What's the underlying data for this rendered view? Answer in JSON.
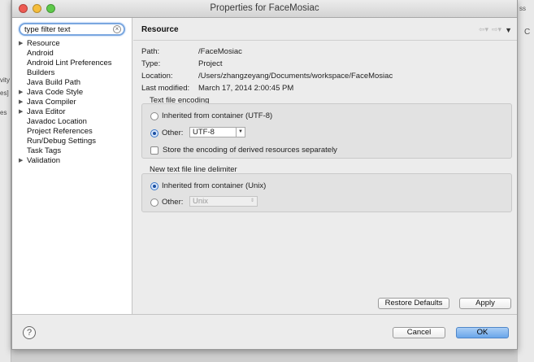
{
  "window": {
    "title": "Properties for FaceMosiac"
  },
  "background": {
    "left_fragments": [
      "vity",
      "es]",
      "es"
    ],
    "right_fragments": [
      "ss",
      "C"
    ]
  },
  "filter": {
    "value": "type filter text"
  },
  "tree": [
    {
      "label": "Resource",
      "has_children": true
    },
    {
      "label": "Android",
      "has_children": false
    },
    {
      "label": "Android Lint Preferences",
      "has_children": false
    },
    {
      "label": "Builders",
      "has_children": false
    },
    {
      "label": "Java Build Path",
      "has_children": false
    },
    {
      "label": "Java Code Style",
      "has_children": true
    },
    {
      "label": "Java Compiler",
      "has_children": true
    },
    {
      "label": "Java Editor",
      "has_children": true
    },
    {
      "label": "Javadoc Location",
      "has_children": false
    },
    {
      "label": "Project References",
      "has_children": false
    },
    {
      "label": "Run/Debug Settings",
      "has_children": false
    },
    {
      "label": "Task Tags",
      "has_children": false
    },
    {
      "label": "Validation",
      "has_children": true
    }
  ],
  "page": {
    "title": "Resource",
    "info": [
      {
        "key": "Path:",
        "value": "/FaceMosiac"
      },
      {
        "key": "Type:",
        "value": "Project"
      },
      {
        "key": "Location:",
        "value": "/Users/zhangzeyang/Documents/workspace/FaceMosiac"
      },
      {
        "key": "Last modified:",
        "value": "March 17, 2014 2:00:45 PM"
      }
    ],
    "encoding": {
      "group_label": "Text file encoding",
      "inherited_label": "Inherited from container (UTF-8)",
      "other_label": "Other:",
      "other_value": "UTF-8",
      "selected": "other",
      "store_label": "Store the encoding of derived resources separately",
      "store_checked": false
    },
    "delimiter": {
      "group_label": "New text file line delimiter",
      "inherited_label": "Inherited from container (Unix)",
      "other_label": "Other:",
      "other_value": "Unix",
      "selected": "inherited"
    },
    "restore_defaults": "Restore Defaults",
    "apply": "Apply"
  },
  "footer": {
    "help": "?",
    "cancel": "Cancel",
    "ok": "OK"
  },
  "colors": {
    "accent": "#6aa6ea",
    "close": "#ee5a52",
    "minimize": "#f5bd3b",
    "maximize": "#5ec94a"
  }
}
